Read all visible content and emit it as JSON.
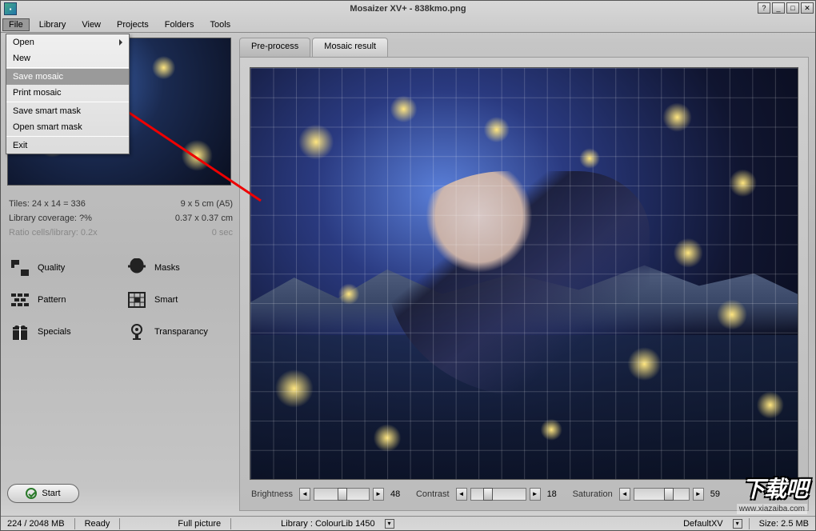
{
  "title": "Mosaizer XV+  - 838kmo.png",
  "menubar": [
    "File",
    "Library",
    "View",
    "Projects",
    "Folders",
    "Tools"
  ],
  "filemenu": {
    "items": [
      {
        "label": "Open",
        "arrow": true
      },
      {
        "label": "New"
      },
      {
        "sep": true
      },
      {
        "label": "Save mosaic",
        "highlight": true
      },
      {
        "label": "Print mosaic"
      },
      {
        "sep": true
      },
      {
        "label": "Save smart mask"
      },
      {
        "label": "Open smart mask"
      },
      {
        "sep": true
      },
      {
        "label": "Exit"
      }
    ]
  },
  "stats": {
    "tiles_label": "Tiles: 24 x 14 = 336",
    "size_label": "9 x 5 cm (A5)",
    "coverage_label": "Library coverage: ?%",
    "cell_label": "0.37 x 0.37 cm",
    "ratio_label": "Ratio cells/library: 0.2x",
    "time_label": "0 sec"
  },
  "tools": [
    {
      "label": "Quality",
      "icon": "quality"
    },
    {
      "label": "Masks",
      "icon": "masks"
    },
    {
      "label": "Pattern",
      "icon": "pattern"
    },
    {
      "label": "Smart",
      "icon": "smart"
    },
    {
      "label": "Specials",
      "icon": "specials"
    },
    {
      "label": "Transparancy",
      "icon": "transparency"
    }
  ],
  "start_label": "Start",
  "tabs": {
    "preprocess": "Pre-process",
    "result": "Mosaic result"
  },
  "sliders": {
    "brightness": {
      "label": "Brightness",
      "value": "48",
      "pos": 42
    },
    "contrast": {
      "label": "Contrast",
      "value": "18",
      "pos": 22
    },
    "saturation": {
      "label": "Saturation",
      "value": "59",
      "pos": 55
    }
  },
  "statusbar": {
    "memory": "224 / 2048 MB",
    "ready": "Ready",
    "fullpic": "Full picture",
    "library": "Library :  ColourLib 1450",
    "default": "DefaultXV",
    "size": "Size: 2.5 MB"
  },
  "watermark": {
    "logo": "下载吧",
    "url": "www.xiazaiba.com"
  }
}
